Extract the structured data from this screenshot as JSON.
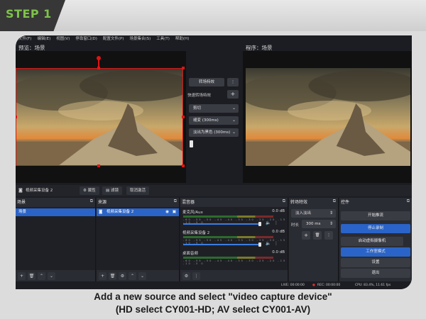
{
  "header": {
    "step_label": "STEP 1"
  },
  "menu": [
    "文件(F)",
    "编辑(E)",
    "视图(V)",
    "停靠窗口(D)",
    "配置文件(P)",
    "场景集合(S)",
    "工具(T)",
    "帮助(H)"
  ],
  "preview": {
    "left_label": "预览：场景",
    "right_label": "程序：场景"
  },
  "transitions_center": {
    "transition_button": "转场特效",
    "more_button": "⋮",
    "quick_transition_label": "快速转场特效",
    "add_button": "+",
    "cut_select": "剪切",
    "fade_select": "褪变 (300ms)",
    "fade_to_black_select": "淡出为黑色 (300ms)"
  },
  "source_bar": {
    "source_name": "视频采集设备 2",
    "properties_button": "属性",
    "filters_button": "滤镜",
    "deactivate_button": "取消激活"
  },
  "docks": {
    "scenes": {
      "title": "场景",
      "items": [
        "场景"
      ]
    },
    "sources": {
      "title": "来源",
      "items": [
        "视频采集设备 2"
      ]
    },
    "mixer": {
      "title": "混音器",
      "channels": [
        {
          "name": "麦克风/Aux",
          "db": "0.0 dB"
        },
        {
          "name": "视频采集设备 2",
          "db": "0.0 dB"
        },
        {
          "name": "桌面音频",
          "db": "0.0 dB"
        }
      ],
      "scale": "-60 -55 -50 -45 -40 -35 -30 -25 -20 -15 -10 -5 0"
    },
    "transitions": {
      "title": "转场特效",
      "select": "淡入淡出",
      "duration_label": "时长",
      "duration_value": "300 ms"
    },
    "controls": {
      "title": "控件",
      "buttons": [
        "开始推流",
        "停止录制",
        "启动虚拟摄像机",
        "工作室模式",
        "设置",
        "退出"
      ]
    }
  },
  "status": {
    "live": "LIVE: 00:00:00",
    "rec": "REC: 00:00:00",
    "cpu": "CPU: 83.4%, 11.61 fps"
  },
  "caption": {
    "line1": "Add a new source and select \"video capture device\"",
    "line2": "(HD select CY001-HD; AV select CY001-AV)"
  },
  "colors": {
    "accent_green": "#7ec24a",
    "selection_red": "#e01414",
    "obs_blue": "#2a64c8"
  }
}
